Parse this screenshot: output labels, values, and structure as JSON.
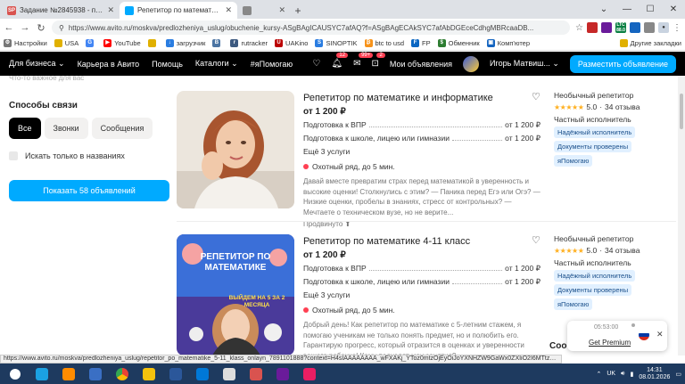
{
  "browser": {
    "tabs": [
      {
        "title": "Задание №2845938 - просмотр з",
        "fav": "SP",
        "color": "#d9534f"
      },
      {
        "title": "Репетитор по математике у метр",
        "fav": "",
        "color": "#00aaff",
        "active": true
      },
      {
        "title": "",
        "fav": "",
        "color": "#888"
      }
    ],
    "url": "https://www.avito.ru/moskva/predlozheniya_uslug/obuchenie_kursy-ASgBAgICAUSYC7afAQ?f=ASgBAgECAkSYC7afAbDGEceCdhgMBRcaaDB...",
    "ltc_label": "LTC",
    "ltc_value": "88.0"
  },
  "bookmarks": [
    {
      "label": "Настройки",
      "icon": "gear",
      "color": "#777"
    },
    {
      "label": "USA",
      "icon": "folder",
      "color": "#e0b000"
    },
    {
      "label": "",
      "icon": "g",
      "color": "#4285f4"
    },
    {
      "label": "YouTube",
      "icon": "yt",
      "color": "#ff0000"
    },
    {
      "label": "",
      "icon": "folder",
      "color": "#e0b000"
    },
    {
      "label": "загрузчик",
      "icon": "dl",
      "color": "#2a7de1"
    },
    {
      "label": "",
      "icon": "vk",
      "color": "#4c75a3"
    },
    {
      "label": "rutracker",
      "icon": "rt",
      "color": "#3d5a80"
    },
    {
      "label": "UAKino",
      "icon": "ua",
      "color": "#b00"
    },
    {
      "label": "SINOPTIK",
      "icon": "sn",
      "color": "#2a7de1"
    },
    {
      "label": "btc to usd",
      "icon": "btc",
      "color": "#f7931a"
    },
    {
      "label": "FP",
      "icon": "fp",
      "color": "#0a66c2"
    },
    {
      "label": "Обменник",
      "icon": "ex",
      "color": "#2e7d32"
    },
    {
      "label": "Комп'ютер",
      "icon": "pc",
      "color": "#1565c0"
    }
  ],
  "bookmarks_other": "Другие закладки",
  "avito_nav": {
    "items": [
      "Для бизнеса ⌄",
      "Карьера в Авито",
      "Помощь",
      "Каталоги ⌄",
      "#яПомогаю"
    ],
    "badges": [
      "12",
      "99+",
      "2"
    ],
    "my_listings": "Мои объявления",
    "user": "Игорь Матвиш... ⌄",
    "post_button": "Разместить объявление"
  },
  "filters": {
    "faded_placeholder": "Что-то важное для вас",
    "contact_heading": "Способы связи",
    "contact_options": [
      "Все",
      "Звонки",
      "Сообщения"
    ],
    "title_only": "Искать только в названиях",
    "show_button": "Показать 58 объявлений"
  },
  "listings": [
    {
      "title": "Репетитор по математике и информатике",
      "price": "от 1 200 ₽",
      "services": [
        {
          "name": "Подготовка к ВПР",
          "price": "от 1 200 ₽"
        },
        {
          "name": "Подготовка к школе, лицею или гимназии",
          "price": "от 1 200 ₽"
        }
      ],
      "more": "Ещё 3 услуги",
      "hunt": "Охотный ряд, до 5 мин.",
      "description": "Давай вместе превратим страх перед математикой в уверенность и высокие оценки! Столкнулись с этим? — Паника перед Егэ или Огэ? — Низкие оценки, пробелы в знаниях, стресс от контрольных? — Мечтаете о техническом вузе, но не верите...",
      "promo": "Продвинуто ⬆",
      "seller_title": "Необычный репетитор",
      "rating": "5.0",
      "reviews": "34 отзыва",
      "seller_type": "Частный исполнитель",
      "tags": [
        "Надёжный исполнитель",
        "Документы проверены",
        "яПомогаю"
      ]
    },
    {
      "title": "Репетитор по математике 4-11 класс",
      "price": "от 1 200 ₽",
      "photo_headline": "РЕПЕТИТОР ПО МАТЕМАТИКЕ",
      "photo_subline": "ВЫЙДЕМ НА 5 ЗА 2 МЕСЯЦА",
      "services": [
        {
          "name": "Подготовка к ВПР",
          "price": "от 1 200 ₽"
        },
        {
          "name": "Подготовка к школе, лицею или гимназии",
          "price": "от 1 200 ₽"
        }
      ],
      "more": "Ещё 3 услуги",
      "hunt": "Охотный ряд, до 5 мин.",
      "description": "Добрый день! Как репетитор по математике с 5-летним стажем, я помогаю ученикам не только понять предмет, но и полюбить его. Гарантирую прогресс, который отразится в оценках и уверенности вашего ребенка! Кому подходят мои занятия?...",
      "seller_title": "Необычный репетитор",
      "rating": "5.0",
      "reviews": "34 отзыва",
      "seller_type": "Частный исполнитель",
      "tags": [
        "Надёжный исполнитель",
        "Документы проверены",
        "яПомогаю"
      ]
    }
  ],
  "widget": {
    "time": "05:53:00",
    "label": "Get Premium"
  },
  "partial_heading": "Соо",
  "status_url": "https://www.avito.ru/moskva/predlozheniya_uslug/repetitor_po_matematike_5-11_klass_onlayn_7891101888?context=H4sIAAAAAAAA_wFXAKj_YToz0mtzOjEyOiJoYXNHZW9GaWx0ZXIiO2I6MTtzOjEzOiJub2NhbFByaW9yaXR5IjtiOjA7czoxOiJ4IjtzOjE2OiJ...",
  "taskbar": {
    "lang": "UK",
    "time": "14:31",
    "date": "08.01.2026",
    "apps": [
      "#1ba1e2",
      "#ff8c00",
      "#3a6fc4",
      "#34a853",
      "#f4c20d",
      "#2b579a",
      "#0078d7",
      "#ddd",
      "#d9534f",
      "#6a1b9a",
      "#e91e63"
    ]
  }
}
